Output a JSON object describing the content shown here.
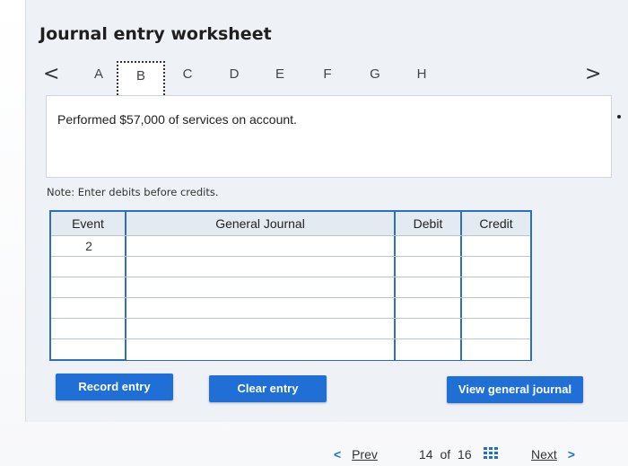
{
  "worksheet": {
    "title": "Journal entry worksheet",
    "tabs": [
      "A",
      "B",
      "C",
      "D",
      "E",
      "F",
      "G",
      "H"
    ],
    "active_tab": "B",
    "prev_tab_glyph": "<",
    "next_tab_glyph": ">"
  },
  "prompt": {
    "text": "Performed $57,000 of services on account."
  },
  "note": "Note: Enter debits before credits.",
  "journal": {
    "headers": {
      "event": "Event",
      "general_journal": "General Journal",
      "debit": "Debit",
      "credit": "Credit"
    },
    "rows": [
      {
        "event": "2",
        "account": "",
        "debit": "",
        "credit": ""
      },
      {
        "event": "",
        "account": "",
        "debit": "",
        "credit": ""
      },
      {
        "event": "",
        "account": "",
        "debit": "",
        "credit": ""
      },
      {
        "event": "",
        "account": "",
        "debit": "",
        "credit": ""
      },
      {
        "event": "",
        "account": "",
        "debit": "",
        "credit": ""
      },
      {
        "event": "",
        "account": "",
        "debit": "",
        "credit": ""
      }
    ]
  },
  "buttons": {
    "record": "Record entry",
    "clear": "Clear entry",
    "view_journal": "View general journal"
  },
  "pager": {
    "prev_glyph": "<",
    "prev_label": "Prev",
    "current": "14",
    "of_label": "of",
    "total": "16",
    "next_label": "Next",
    "next_glyph": ">"
  },
  "colors": {
    "accent": "#1f6fd6",
    "table_border": "#2d6fc1",
    "header_bg": "#e4eaf2"
  }
}
